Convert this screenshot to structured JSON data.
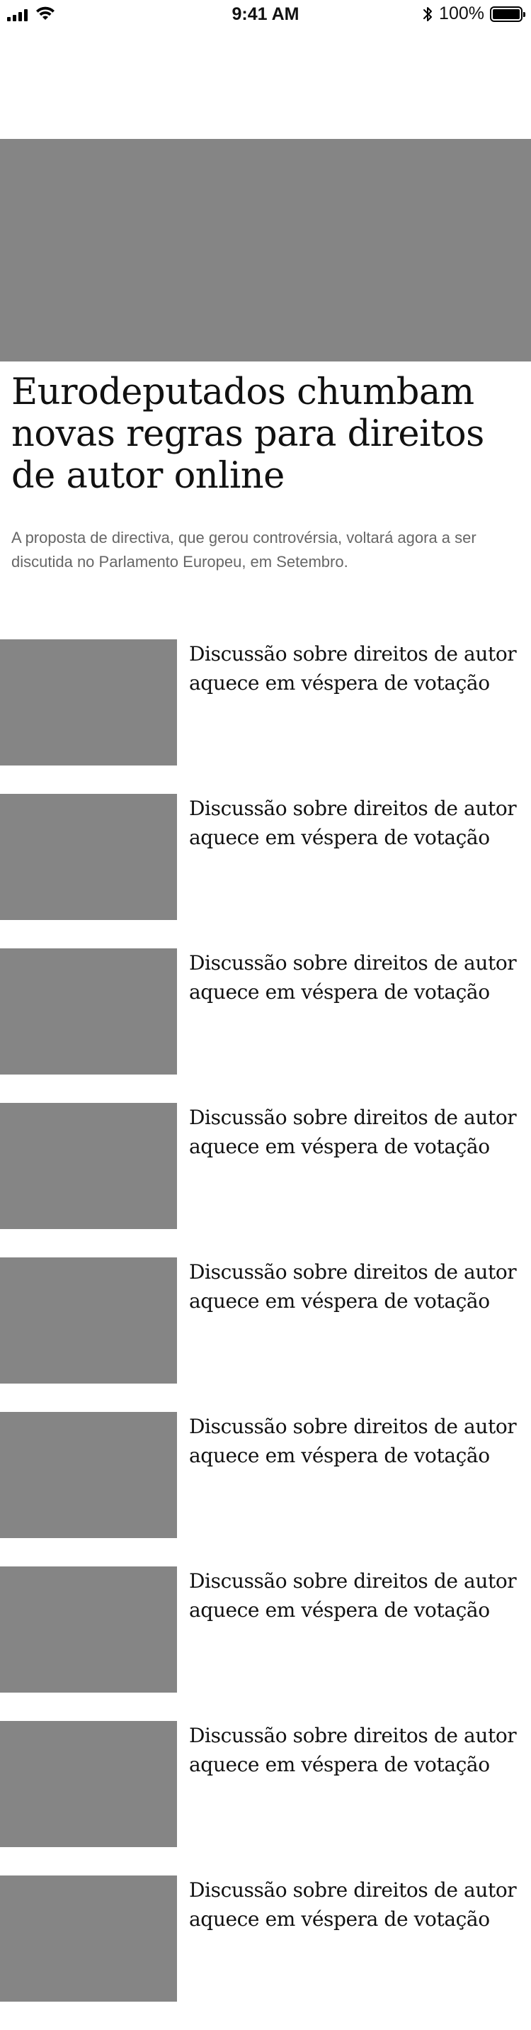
{
  "status_bar": {
    "time": "9:41 AM",
    "battery_percent": "100%",
    "battery_level": 1.0,
    "icons": [
      "signal-icon",
      "wifi-icon",
      "bluetooth-icon",
      "battery-icon"
    ]
  },
  "hero": {
    "image": "article-image-placeholder",
    "title": "Eurodeputados chumbam novas regras para direitos de autor online",
    "summary": "A proposta de directiva, que gerou controvérsia, voltará agora a ser discutida no Parlamento Europeu, em Setembro."
  },
  "articles": [
    {
      "title": "Discussão sobre direitos de autor aquece em véspera de votação"
    },
    {
      "title": "Discussão sobre direitos de autor aquece em véspera de votação"
    },
    {
      "title": "Discussão sobre direitos de autor aquece em véspera de votação"
    },
    {
      "title": "Discussão sobre direitos de autor aquece em véspera de votação"
    },
    {
      "title": "Discussão sobre direitos de autor aquece em véspera de votação"
    },
    {
      "title": "Discussão sobre direitos de autor aquece em véspera de votação"
    },
    {
      "title": "Discussão sobre direitos de autor aquece em véspera de votação"
    },
    {
      "title": "Discussão sobre direitos de autor aquece em véspera de votação"
    },
    {
      "title": "Discussão sobre direitos de autor aquece em véspera de votação"
    }
  ],
  "colors": {
    "placeholder": "#858585",
    "title_text": "#111111",
    "summary_text": "#666666",
    "background": "#ffffff"
  }
}
